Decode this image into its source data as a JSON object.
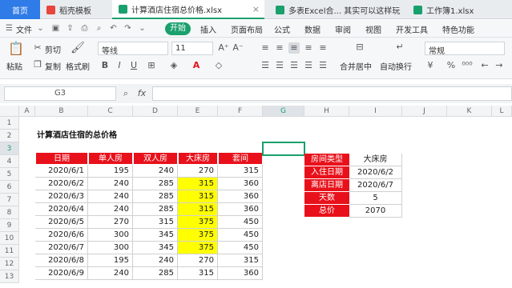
{
  "tabs": [
    {
      "label": "首页"
    },
    {
      "label": "稻壳模板",
      "icon_color": "#e8453c"
    },
    {
      "label": "计算酒店住宿总价格.xlsx",
      "icon_color": "#1aa06d"
    },
    {
      "label": "多表Excel合... 其实可以这样玩",
      "icon_color": "#1aa06d"
    },
    {
      "label": "工作簿1.xlsx",
      "icon_color": "#1aa06d"
    }
  ],
  "menu": {
    "file": "文件",
    "start": "开始",
    "items": [
      "插入",
      "页面布局",
      "公式",
      "数据",
      "审阅",
      "视图",
      "开发工具",
      "特色功能"
    ]
  },
  "ribbon": {
    "paste": "粘贴",
    "cut": "剪切",
    "copy": "复制",
    "format_painter": "格式刷",
    "font_name": "等线",
    "font_size": "11",
    "merge_center": "合并居中",
    "wrap_text": "自动换行",
    "number_format": "常规"
  },
  "formula_bar": {
    "cell_ref": "G3",
    "fx": "fx"
  },
  "columns": [
    "A",
    "B",
    "C",
    "D",
    "E",
    "F",
    "G",
    "H",
    "I",
    "J",
    "K",
    "L"
  ],
  "rows": [
    "1",
    "2",
    "3",
    "4",
    "5",
    "6",
    "7",
    "8",
    "9",
    "10",
    "11",
    "12",
    "13"
  ],
  "sheet": {
    "title": "计算酒店住宿的总价格",
    "headers": [
      "日期",
      "单人房",
      "双人房",
      "大床房",
      "套间"
    ],
    "data": [
      [
        "2020/6/1",
        "195",
        "240",
        "270",
        "315"
      ],
      [
        "2020/6/2",
        "240",
        "285",
        "315",
        "360"
      ],
      [
        "2020/6/3",
        "240",
        "285",
        "315",
        "360"
      ],
      [
        "2020/6/4",
        "240",
        "285",
        "315",
        "360"
      ],
      [
        "2020/6/5",
        "270",
        "315",
        "375",
        "450"
      ],
      [
        "2020/6/6",
        "300",
        "345",
        "375",
        "450"
      ],
      [
        "2020/6/7",
        "300",
        "345",
        "375",
        "450"
      ],
      [
        "2020/6/8",
        "195",
        "240",
        "270",
        "315"
      ],
      [
        "2020/6/9",
        "240",
        "285",
        "315",
        "360"
      ]
    ],
    "highlight_rows": [
      1,
      2,
      3,
      4,
      5,
      6
    ],
    "highlight_color": "#ffff00",
    "info": [
      {
        "label": "房间类型",
        "value": "大床房"
      },
      {
        "label": "入住日期",
        "value": "2020/6/2"
      },
      {
        "label": "离店日期",
        "value": "2020/6/7"
      },
      {
        "label": "天数",
        "value": "5"
      },
      {
        "label": "总价",
        "value": "2070"
      }
    ]
  },
  "colors": {
    "accent": "#1aa06d",
    "header_red": "#e8111b",
    "home_tab": "#2f7be7"
  }
}
